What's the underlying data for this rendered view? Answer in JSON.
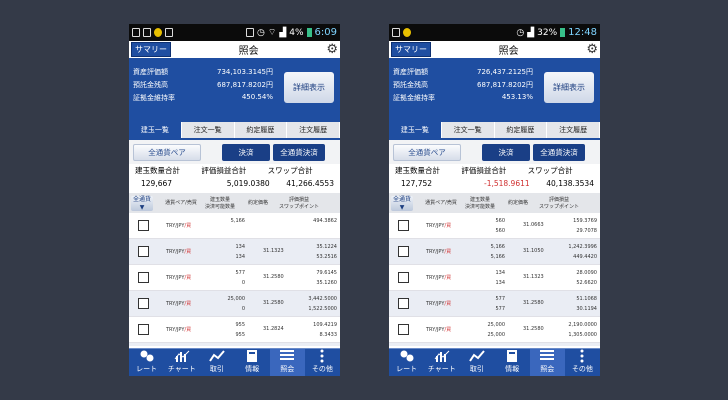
{
  "screens": [
    {
      "status": {
        "left_icons": "mail cart lock chat",
        "battery": "4%",
        "time": "6:09"
      },
      "header": {
        "summary_button": "サマリー",
        "title": "照会"
      },
      "summary": [
        {
          "label": "資産評価額",
          "value": "734,103.3145円"
        },
        {
          "label": "預託金残高",
          "value": "687,817.8202円"
        },
        {
          "label": "証拠金維持率",
          "value": "450.54%"
        }
      ],
      "detail_button": "詳細表示",
      "tabs": [
        "建玉一覧",
        "注文一覧",
        "約定履歴",
        "注文履歴"
      ],
      "buttons": {
        "all_pair": "全通貨ペア",
        "settle": "決済",
        "all_settle": "全通貨決済"
      },
      "totals": {
        "labels": [
          "建玉数量合計",
          "評価損益合計",
          "スワップ合計"
        ],
        "values": [
          "129,667",
          "5,019.0380",
          "41,266.4553"
        ]
      },
      "columns": {
        "all": "全通貨",
        "pair": "通貨ペア/売買",
        "qty": "建玉数量\n決済可能数量",
        "price": "約定価格",
        "swap": "評価損益\nスワップポイント"
      },
      "rows": [
        {
          "pair": "TRY/JPY",
          "side": "/買",
          "qty1": "",
          "qty2": "5,166",
          "price": "",
          "pl": "",
          "swap": "494.3862"
        },
        {
          "pair": "TRY/JPY",
          "side": "/買",
          "qty1": "134",
          "qty2": "134",
          "price": "31.1323",
          "pl": "35.1224",
          "swap": "53.2516"
        },
        {
          "pair": "TRY/JPY",
          "side": "/買",
          "qty1": "577",
          "qty2": "0",
          "price": "31.2580",
          "pl": "79.6145",
          "swap": "35.1260"
        },
        {
          "pair": "TRY/JPY",
          "side": "/買",
          "qty1": "25,000",
          "qty2": "0",
          "price": "31.2580",
          "pl": "3,442.5000",
          "swap": "1,522.5000"
        },
        {
          "pair": "TRY/JPY",
          "side": "/買",
          "qty1": "955",
          "qty2": "955",
          "price": "31.2824",
          "pl": "109.4219",
          "swap": "8.3433"
        },
        {
          "pair": "TRY/JPY",
          "side": "/買",
          "qty1": "955",
          "qty2": "955",
          "price": "31.3670",
          "pl": "28.2820",
          "swap": "8.3172"
        }
      ],
      "nav": [
        "レート",
        "チャート",
        "取引",
        "情報",
        "照会",
        "その他"
      ]
    },
    {
      "status": {
        "left_icons": "mail lock",
        "battery": "32%",
        "time": "12:48"
      },
      "header": {
        "summary_button": "サマリー",
        "title": "照会"
      },
      "summary": [
        {
          "label": "資産評価額",
          "value": "726,437.2125円"
        },
        {
          "label": "預託金残高",
          "value": "687,817.8202円"
        },
        {
          "label": "証拠金維持率",
          "value": "453.13%"
        }
      ],
      "detail_button": "詳細表示",
      "tabs": [
        "建玉一覧",
        "注文一覧",
        "約定履歴",
        "注文履歴"
      ],
      "buttons": {
        "all_pair": "全通貨ペア",
        "settle": "決済",
        "all_settle": "全通貨決済"
      },
      "totals": {
        "labels": [
          "建玉数量合計",
          "評価損益合計",
          "スワップ合計"
        ],
        "values": [
          "127,752",
          "-1,518.9611",
          "40,138.3534"
        ]
      },
      "columns": {
        "all": "全通貨",
        "pair": "通貨ペア/売買",
        "qty": "建玉数量\n決済可能数量",
        "price": "約定価格",
        "swap": "評価損益\nスワップポイント"
      },
      "rows": [
        {
          "pair": "TRY/JPY",
          "side": "/買",
          "qty1": "560",
          "qty2": "560",
          "price": "31.0663",
          "pl": "159.3769",
          "swap": "29.7078"
        },
        {
          "pair": "TRY/JPY",
          "side": "/買",
          "qty1": "5,166",
          "qty2": "5,166",
          "price": "31.1050",
          "pl": "1,242.3996",
          "swap": "449.4420"
        },
        {
          "pair": "TRY/JPY",
          "side": "/買",
          "qty1": "134",
          "qty2": "134",
          "price": "31.1323",
          "pl": "28.0090",
          "swap": "52.6620"
        },
        {
          "pair": "TRY/JPY",
          "side": "/買",
          "qty1": "577",
          "qty2": "577",
          "price": "31.2580",
          "pl": "51.1068",
          "swap": "30.1194"
        },
        {
          "pair": "TRY/JPY",
          "side": "/買",
          "qty1": "25,000",
          "qty2": "25,000",
          "price": "31.2580",
          "pl": "2,190.0000",
          "swap": "1,305.0000"
        },
        {
          "pair": "",
          "side": "",
          "qty1": "96,305",
          "qty2": "",
          "price": "",
          "pl": "-5,190.6934",
          "swap": ""
        }
      ],
      "nav": [
        "レート",
        "チャート",
        "取引",
        "情報",
        "照会",
        "その他"
      ]
    }
  ]
}
